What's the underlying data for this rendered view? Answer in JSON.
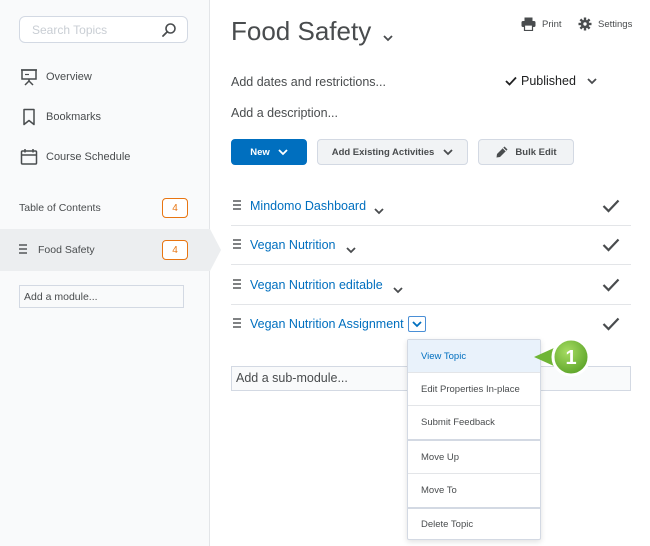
{
  "sidebar": {
    "search_placeholder": "Search Topics",
    "nav": [
      {
        "label": "Overview",
        "icon": "presentation-icon"
      },
      {
        "label": "Bookmarks",
        "icon": "bookmark-icon"
      },
      {
        "label": "Course Schedule",
        "icon": "calendar-icon"
      }
    ],
    "toc": {
      "label": "Table of Contents",
      "count": "4"
    },
    "module": {
      "label": "Food Safety",
      "count": "4"
    },
    "add_module": "Add a module..."
  },
  "header": {
    "title": "Food Safety",
    "print_label": "Print",
    "settings_label": "Settings"
  },
  "module": {
    "dates_label": "Add dates and restrictions...",
    "status_label": "Published",
    "description_label": "Add a description..."
  },
  "toolbar": {
    "new_label": "New",
    "add_existing_label": "Add Existing Activities",
    "bulk_edit_label": "Bulk Edit"
  },
  "topics": [
    {
      "title": "Mindomo Dashboard"
    },
    {
      "title": "Vegan Nutrition"
    },
    {
      "title": "Vegan Nutrition editable"
    },
    {
      "title": "Vegan Nutrition Assignment"
    }
  ],
  "add_submodule": "Add a sub-module...",
  "context_menu": {
    "items": [
      "View Topic",
      "Edit Properties In-place",
      "Submit Feedback",
      "Move Up",
      "Move To",
      "Delete Topic"
    ]
  },
  "callout": {
    "number": "1"
  },
  "colors": {
    "accent": "#006fbf",
    "badge": "#e87511",
    "callout_green": "#7cc03e"
  }
}
